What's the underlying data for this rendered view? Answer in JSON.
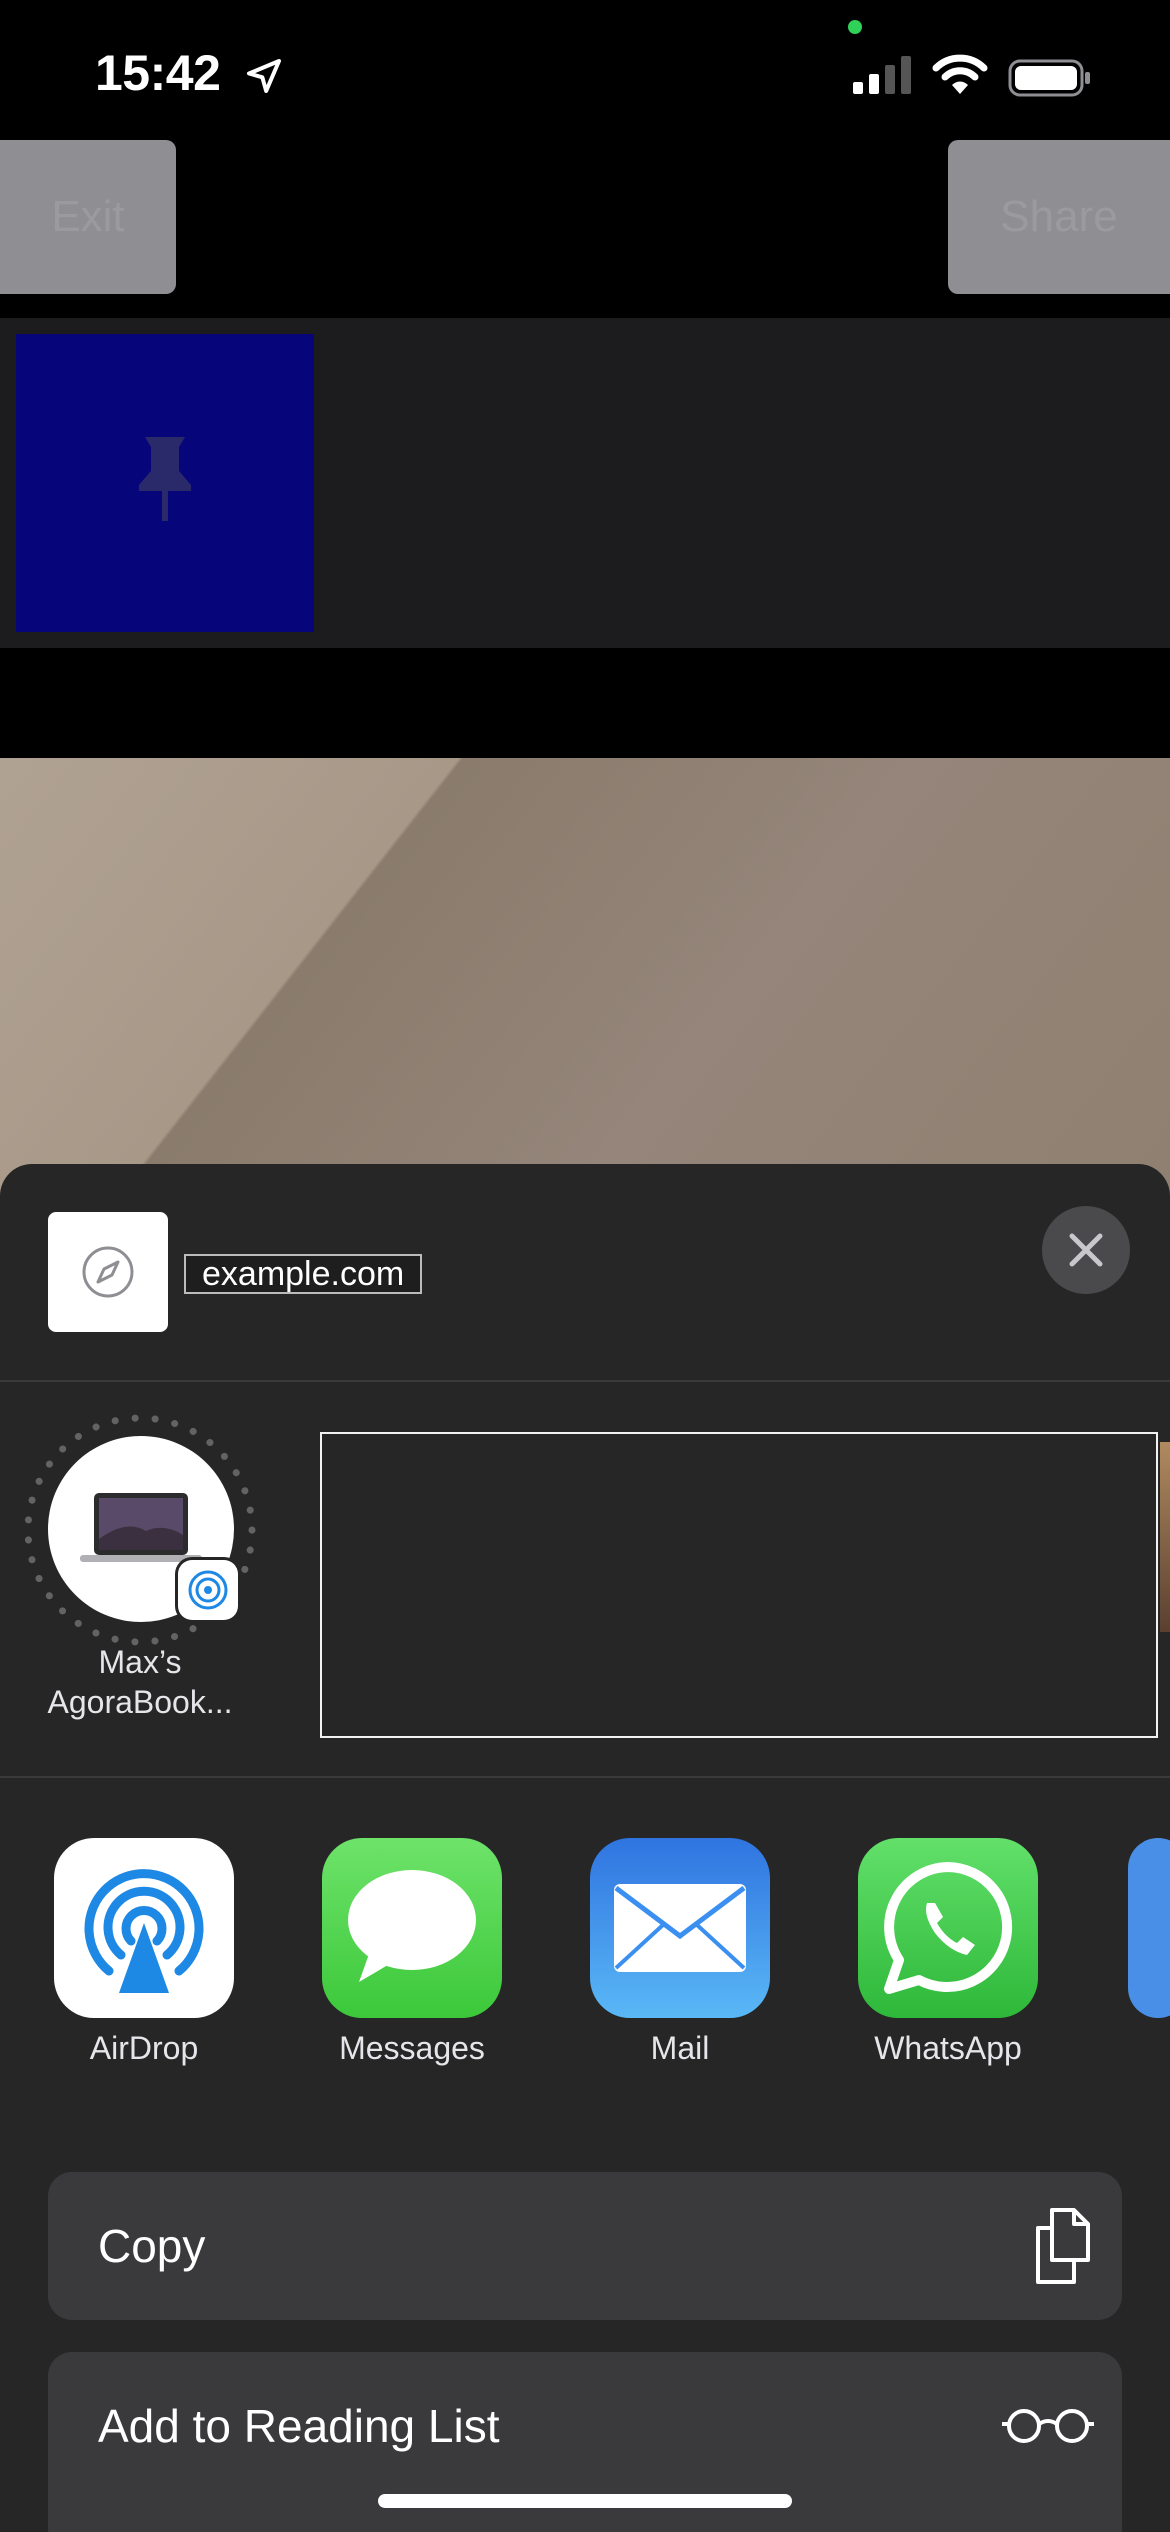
{
  "status_bar": {
    "time": "15:42"
  },
  "app_bar": {
    "exit_label": "Exit",
    "share_label": "Share"
  },
  "share_sheet": {
    "url": "example.com",
    "airdrop_device": {
      "name": "Max’s AgoraBook..."
    },
    "apps": [
      {
        "label": "AirDrop",
        "icon": "airdrop-icon",
        "color": "#ffffff"
      },
      {
        "label": "Messages",
        "icon": "messages-icon",
        "color": "#4cd964"
      },
      {
        "label": "Mail",
        "icon": "mail-icon",
        "color": "#3a8ff0"
      },
      {
        "label": "WhatsApp",
        "icon": "whatsapp-icon",
        "color": "#4cd964"
      }
    ],
    "actions": [
      {
        "label": "Copy",
        "icon": "copy-icon"
      },
      {
        "label": "Add to Reading List",
        "icon": "glasses-icon"
      }
    ]
  }
}
